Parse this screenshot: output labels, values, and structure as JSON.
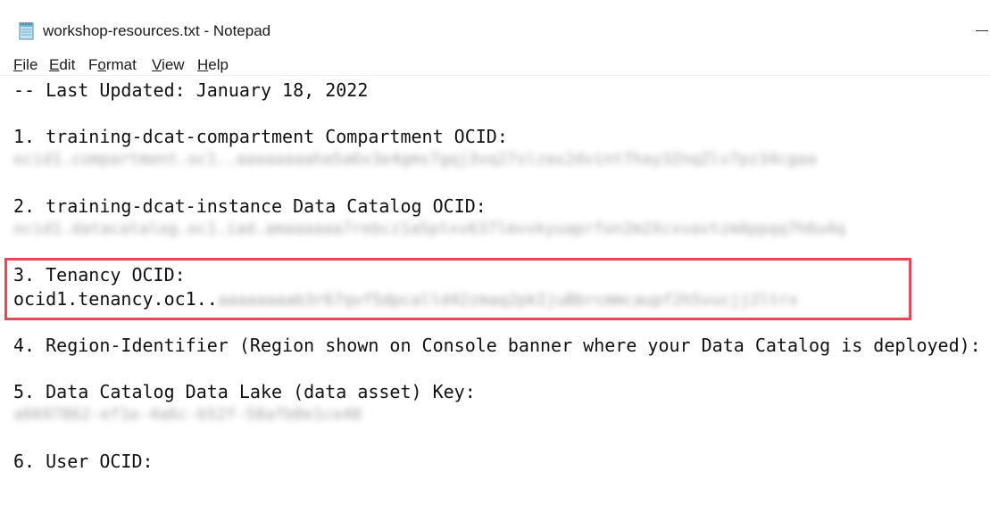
{
  "window": {
    "title": "workshop-resources.txt - Notepad",
    "icon": "notepad-icon",
    "minimize_icon": "minimize-icon"
  },
  "menu": {
    "items": [
      {
        "label": "File",
        "accel": "F",
        "rest": "ile"
      },
      {
        "label": "Edit",
        "accel": "E",
        "rest": "dit"
      },
      {
        "label": "Format",
        "accel": "o",
        "pre": "F",
        "rest": "rmat"
      },
      {
        "label": "View",
        "accel": "V",
        "rest": "iew"
      },
      {
        "label": "Help",
        "accel": "H",
        "rest": "elp"
      }
    ]
  },
  "document": {
    "line_updated": "-- Last Updated: January 18, 2022",
    "line_1": "1. training-dcat-compartment Compartment OCID:",
    "line_1_value": "ocid1.compartment.oc1..aaaaaaaaha5a6x3e4gms7gqj3vq27slzas2dvint7hay3ZnqZlv7pz34cgaa",
    "line_2": "2. training-dcat-instance Data Catalog OCID:",
    "line_2_value": "ocid1.datacatalog.oc1.iad.amaaaaaa7rebcz1a5ptxv637lmvvkyuaprfon2m2XcxvavtzmAppqq7h6u4q",
    "line_3": "3. Tenancy OCID:",
    "line_3_prefix": "ocid1.tenancy.oc1..",
    "line_3_value": "aaaaaaaab3r67qvf5dpcalld42zmaq2pkIjuBbrcmmcaupf2h5vucjj2ltrx",
    "line_4": "4. Region-Identifier (Region shown on Console banner where your Data Catalog is deployed):",
    "line_5": "5. Data Catalog Data Lake (data asset) Key:",
    "line_5_value": "a6697862-ef1e-4a6c-b52f-58afb0e1ce40",
    "line_6": "6. User OCID:"
  },
  "colors": {
    "highlight_border": "#e24a55",
    "text": "#111111",
    "background": "#ffffff"
  }
}
